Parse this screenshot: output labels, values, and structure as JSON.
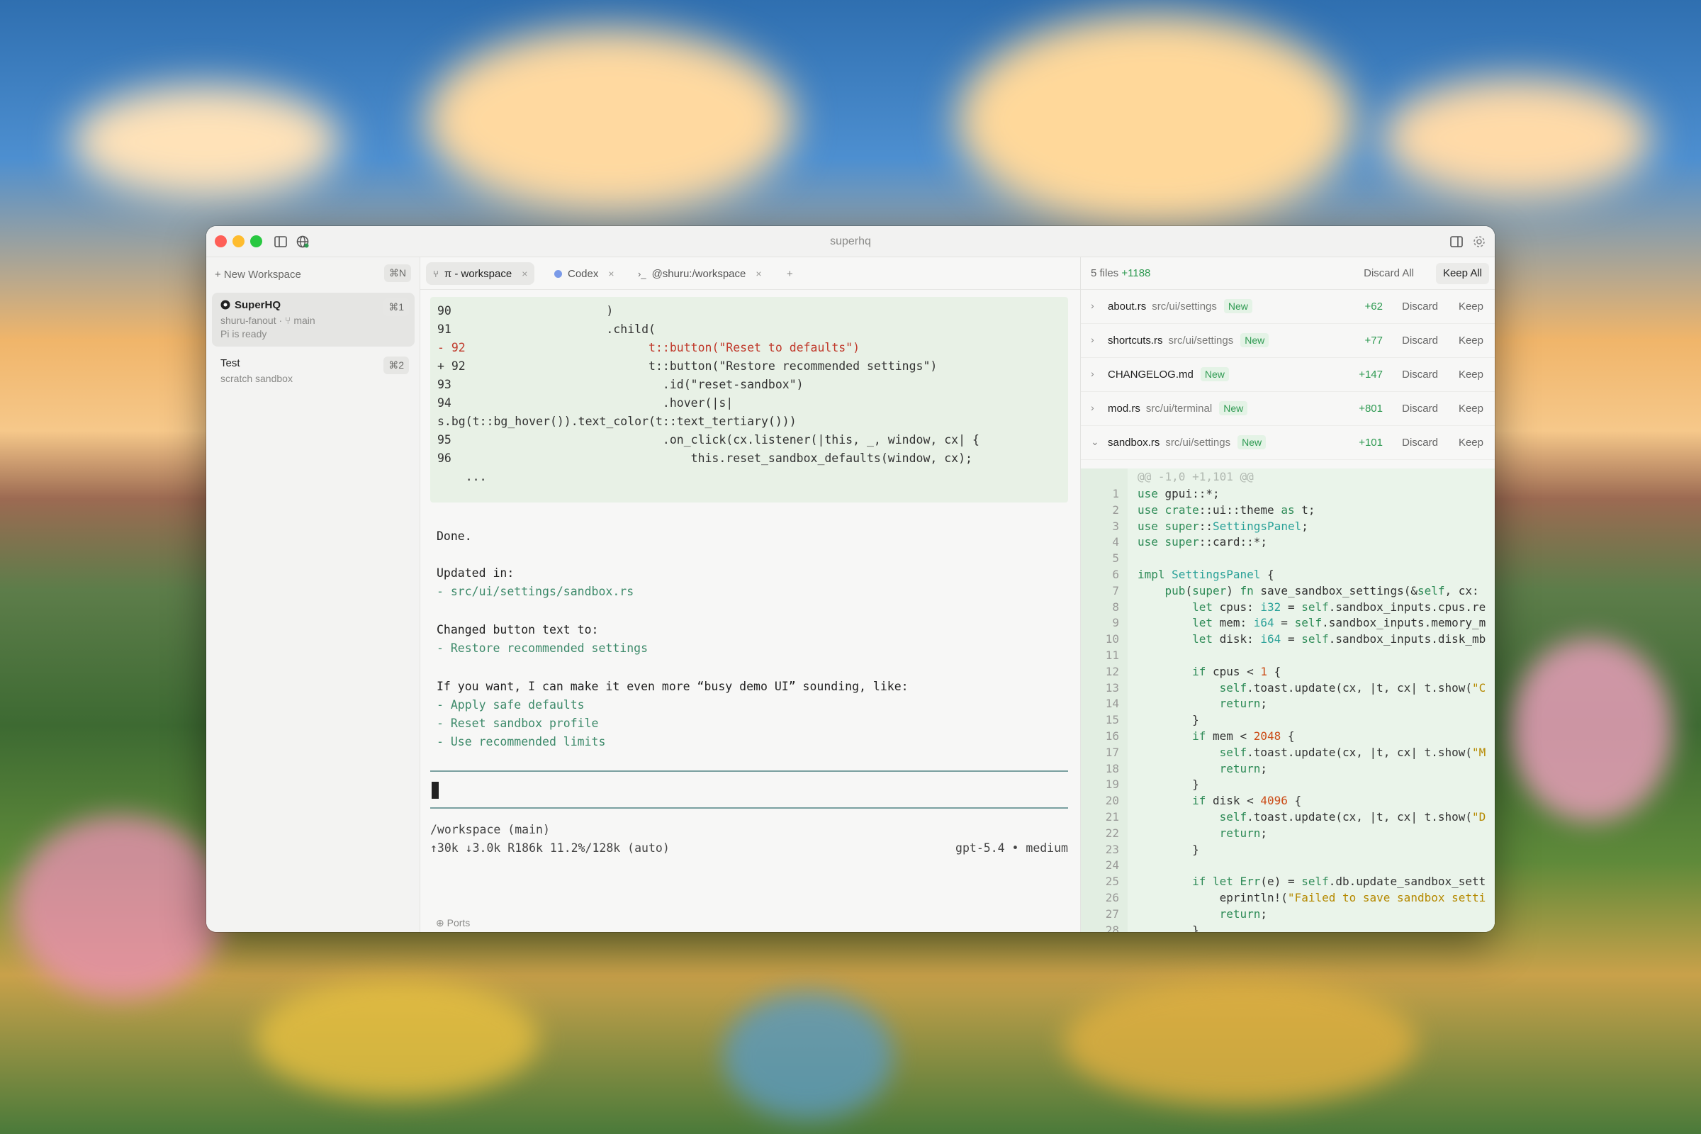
{
  "window": {
    "title": "superhq"
  },
  "sidebar": {
    "new_workspace": "+ New Workspace",
    "new_workspace_shortcut": "⌘N",
    "workspaces": [
      {
        "name": "SuperHQ",
        "shortcut": "⌘1",
        "branch_line": "shuru-fanout · ⑂ main",
        "status": "Pi is ready"
      },
      {
        "name": "Test",
        "shortcut": "⌘2",
        "status": "scratch sandbox"
      }
    ]
  },
  "tabs": [
    {
      "label": "π - workspace",
      "icon": "pi-icon"
    },
    {
      "label": "Codex",
      "icon": "codex-dot-icon"
    },
    {
      "label": "@shuru:/workspace",
      "icon": "terminal-icon"
    }
  ],
  "tab_add": "+",
  "code_block": [
    {
      "num": "90",
      "text": "                    )",
      "type": "ctx"
    },
    {
      "num": "91",
      "text": "                    .child(",
      "type": "ctx"
    },
    {
      "num": "- 92",
      "text": "                        t::button(\"Reset to defaults\")",
      "type": "del"
    },
    {
      "num": "+ 92",
      "text": "                        t::button(\"Restore recommended settings\")",
      "type": "add"
    },
    {
      "num": "93",
      "text": "                            .id(\"reset-sandbox\")",
      "type": "ctx"
    },
    {
      "num": "94",
      "text": "                            .hover(|s|",
      "type": "ctx"
    },
    {
      "num": "",
      "text": "s.bg(t::bg_hover()).text_color(t::text_tertiary()))",
      "type": "wrap"
    },
    {
      "num": "95",
      "text": "                            .on_click(cx.listener(|this, _, window, cx| {",
      "type": "ctx"
    },
    {
      "num": "96",
      "text": "                                this.reset_sandbox_defaults(window, cx);",
      "type": "ctx"
    },
    {
      "num": "",
      "text": "    ...",
      "type": "ellipsis"
    }
  ],
  "message": {
    "done": "Done.",
    "updated_in": "Updated in:",
    "updated_file": "- src/ui/settings/sandbox.rs",
    "changed_text": "Changed button text to:",
    "changed_value": "- Restore recommended settings",
    "suggest": "If you want, I can make it even more “busy demo UI” sounding, like:",
    "options": [
      "- Apply safe defaults",
      "- Reset sandbox profile",
      "- Use recommended limits"
    ]
  },
  "status": {
    "cwd": "/workspace (main)",
    "tokens": "↑30k ↓3.0k R186k 11.2%/128k (auto)",
    "model": "gpt-5.4 • medium"
  },
  "ports": "Ports",
  "changes": {
    "files": "5 files",
    "total": "+1188",
    "discard_all": "Discard All",
    "keep_all": "Keep All",
    "discard": "Discard",
    "keep": "Keep",
    "new_badge": "New",
    "items": [
      {
        "name": "about.rs",
        "path": "src/ui/settings",
        "plus": "+62",
        "expanded": false
      },
      {
        "name": "shortcuts.rs",
        "path": "src/ui/settings",
        "plus": "+77",
        "expanded": false
      },
      {
        "name": "CHANGELOG.md",
        "path": "",
        "plus": "+147",
        "expanded": false
      },
      {
        "name": "mod.rs",
        "path": "src/ui/terminal",
        "plus": "+801",
        "expanded": false
      },
      {
        "name": "sandbox.rs",
        "path": "src/ui/settings",
        "plus": "+101",
        "expanded": true
      }
    ],
    "hunk": "@@ -1,0 +1,101 @@"
  },
  "diff_lines": [
    "use gpui::*;",
    "use crate::ui::theme as t;",
    "use super::SettingsPanel;",
    "use super::card::*;",
    "",
    "impl SettingsPanel {",
    "    pub(super) fn save_sandbox_settings(&self, cx:",
    "        let cpus: i32 = self.sandbox_inputs.cpus.re",
    "        let mem: i64 = self.sandbox_inputs.memory_m",
    "        let disk: i64 = self.sandbox_inputs.disk_mb",
    "",
    "        if cpus < 1 {",
    "            self.toast.update(cx, |t, cx| t.show(\"C",
    "            return;",
    "        }",
    "        if mem < 2048 {",
    "            self.toast.update(cx, |t, cx| t.show(\"M",
    "            return;",
    "        }",
    "        if disk < 4096 {",
    "            self.toast.update(cx, |t, cx| t.show(\"D",
    "            return;",
    "        }",
    "",
    "        if let Err(e) = self.db.update_sandbox_sett",
    "            eprintln!(\"Failed to save sandbox setti",
    "            return;",
    "        }"
  ]
}
